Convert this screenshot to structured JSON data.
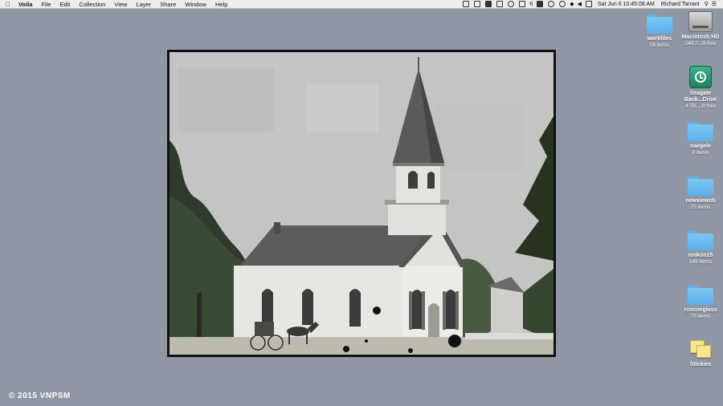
{
  "menubar": {
    "apple_icon": "apple-icon",
    "app_name": "Voila",
    "menus": [
      "File",
      "Edit",
      "Collection",
      "View",
      "Layer",
      "Share",
      "Window",
      "Help"
    ],
    "status": {
      "battery_count": "6",
      "datetime": "Sat Jun 6  10:45:08 AM",
      "user": "Richard Tarrant"
    }
  },
  "photo": {
    "description_icon": "church-photograph"
  },
  "desktop": {
    "items": [
      {
        "label": "workfiles",
        "sub": "58 items",
        "kind": "folder"
      },
      {
        "label": "Macintosh HD",
        "sub": "249.2...B free",
        "kind": "disk"
      },
      {
        "label": "Seagate Back...Drive",
        "sub": "4 TB,...B free",
        "kind": "timemachine"
      },
      {
        "label": "naegele",
        "sub": "8 items",
        "kind": "folder"
      },
      {
        "label": "newviewsb",
        "sub": "75 items",
        "kind": "folder"
      },
      {
        "label": "nnikon15",
        "sub": "149 items",
        "kind": "folder"
      },
      {
        "label": "roscoeglass",
        "sub": "75 items",
        "kind": "folder"
      },
      {
        "label": "Stickies",
        "sub": "",
        "kind": "app"
      }
    ]
  },
  "watermark": "© 2015 VNPSM",
  "colors": {
    "desktop_bg": "#8f97a5",
    "folder_blue": "#5bb1ea"
  }
}
